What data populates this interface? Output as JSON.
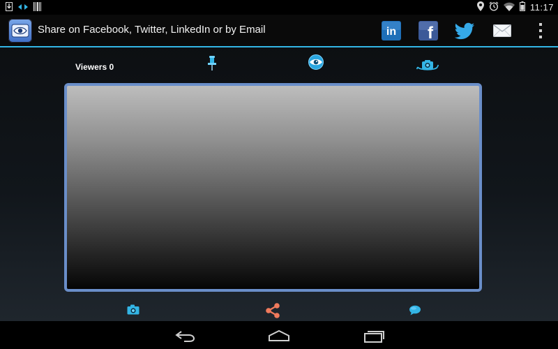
{
  "status_bar": {
    "time": "11:17",
    "left_icons": [
      "download-icon",
      "data-transfer-icon",
      "barcode-icon"
    ],
    "right_icons": [
      "location-icon",
      "alarm-icon",
      "wifi-icon",
      "battery-icon"
    ]
  },
  "action_bar": {
    "title": "Share on Facebook, Twitter, LinkedIn or by Email",
    "app_icon": "eye-icon",
    "share_buttons": [
      {
        "name": "linkedin",
        "label": "in",
        "color": "#1e6fb8"
      },
      {
        "name": "facebook",
        "label": "f",
        "color": "#3b5998"
      },
      {
        "name": "twitter",
        "icon": "twitter-bird-icon",
        "color": "#35a9e8"
      },
      {
        "name": "email",
        "icon": "envelope-icon",
        "color": "#ffffff"
      }
    ],
    "overflow_icon": "overflow-menu-icon",
    "accent_color": "#33b5e5"
  },
  "controls_top": {
    "viewers_label": "Viewers 0",
    "pin_icon": "pin-icon",
    "eye_icon": "eye-icon",
    "switch_camera_icon": "switch-camera-icon"
  },
  "preview": {
    "border_color": "#6a8ec9"
  },
  "controls_bottom": {
    "camera_icon": "camera-icon",
    "share_icon": "share-icon",
    "chat_icon": "chat-icon",
    "share_color": "#f07a5c"
  },
  "nav_bar": {
    "back_icon": "back-icon",
    "home_icon": "home-icon",
    "recents_icon": "recents-icon"
  }
}
